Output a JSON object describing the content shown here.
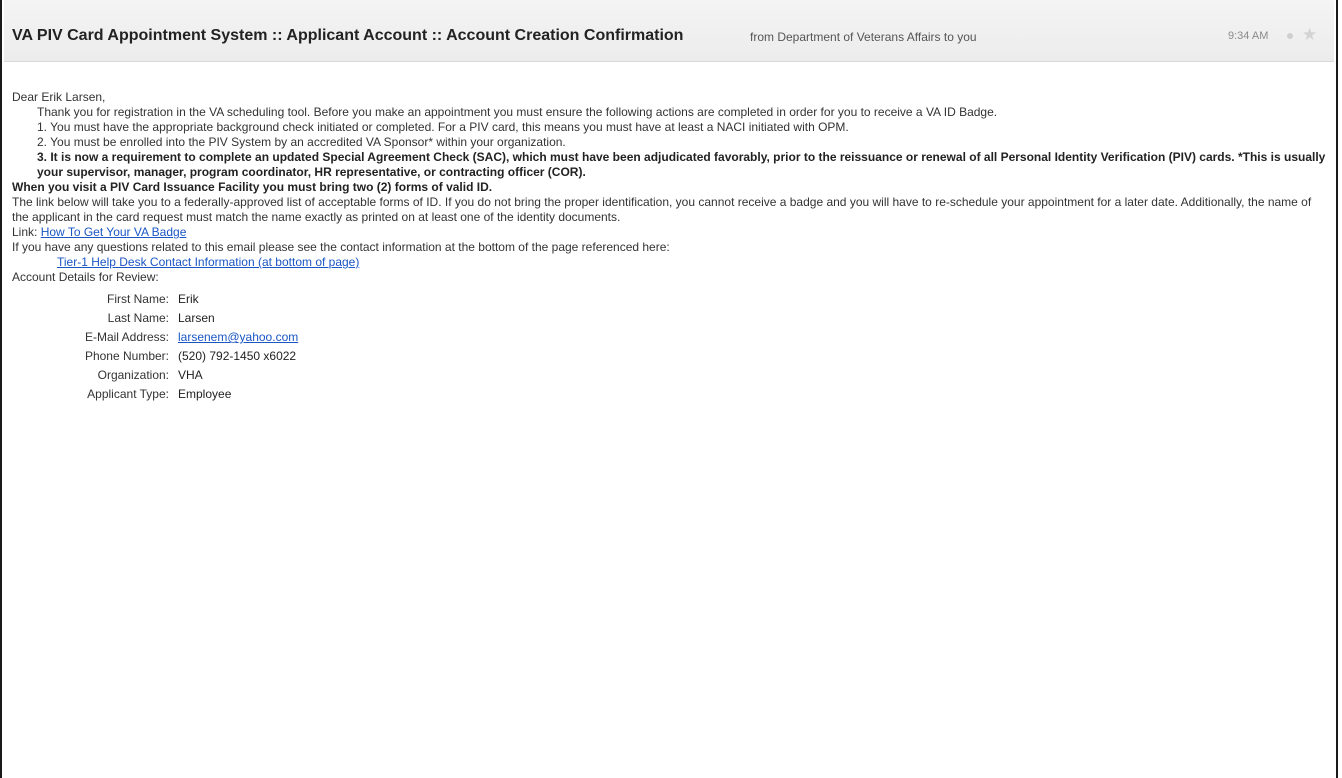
{
  "email": {
    "subject": "VA PIV Card Appointment System :: Applicant Account :: Account Creation Confirmation",
    "sender": "from Department of Veterans Affairs to you",
    "time": "9:34 AM"
  },
  "body": {
    "greeting": "Dear Erik Larsen,",
    "intro": "Thank you for registration in the VA scheduling tool. Before you make an appointment you must ensure the following actions are completed in order for you to receive a VA ID Badge.",
    "item1": "1. You must have the appropriate background check initiated or completed. For a PIV card, this means you must have at least a NACI initiated with OPM.",
    "item2": "2. You must be enrolled into the PIV System by an accredited VA Sponsor* within your organization.",
    "item3": "3. It is now a requirement to complete an updated Special Agreement Check (SAC), which must have been adjudicated favorably, prior to the reissuance or renewal of all Personal Identity Verification (PIV) cards. *This is usually your supervisor, manager, program coordinator, HR representative, or contracting officer (COR).",
    "visit_notice": "When you visit a PIV Card Issuance Facility you must bring two (2) forms of valid ID.",
    "id_paragraph": "The link below will take you to a federally-approved list of acceptable forms of ID. If you do not bring the proper identification, you cannot receive a badge and you will have to re-schedule your appointment for a later date. Additionally, the name of the applicant in the card request must match the name exactly as printed on at least one of the identity documents.",
    "link_prefix": "Link:",
    "link_text": "How To Get Your VA Badge",
    "questions": "If you have any questions related to this email please see the contact information at the bottom of the page referenced here:",
    "helpdesk_link": "Tier-1 Help Desk Contact Information (at bottom of page)",
    "details_heading": "Account Details for Review:"
  },
  "details": [
    {
      "label": "First Name:",
      "value": "Erik"
    },
    {
      "label": "Last Name:",
      "value": "Larsen"
    },
    {
      "label": "E-Mail Address:",
      "value": "larsenem@yahoo.com"
    },
    {
      "label": "Phone Number:",
      "value": "(520) 792-1450 x6022"
    },
    {
      "label": "Organization:",
      "value": "VHA"
    },
    {
      "label": "Applicant Type:",
      "value": "Employee"
    }
  ],
  "icons": {
    "status": "status-dot-icon",
    "star": "star-icon"
  }
}
